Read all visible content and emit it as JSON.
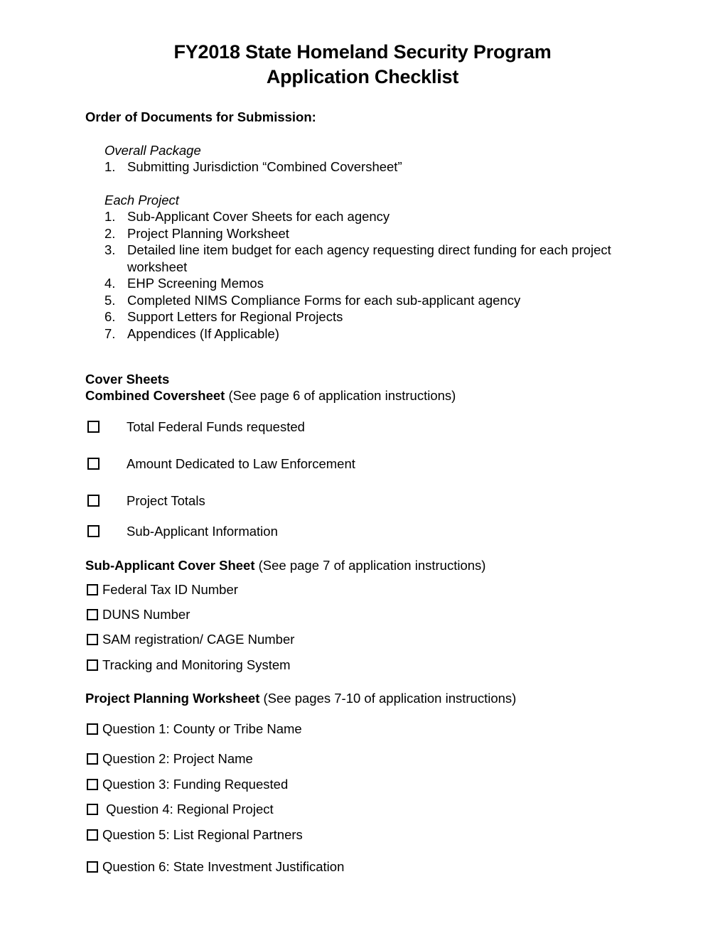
{
  "document": {
    "title_line1": "FY2018 State Homeland Security Program",
    "title_line2": "Application Checklist",
    "order_heading": "Order of Documents for Submission:"
  },
  "order_of_documents": {
    "groups": [
      {
        "name": "overall-package",
        "heading": "Overall Package",
        "items": [
          {
            "number": "1.",
            "text": "Submitting Jurisdiction “Combined Coversheet”"
          }
        ]
      },
      {
        "name": "each-project",
        "heading": "Each Project",
        "items": [
          {
            "number": "1.",
            "text": "Sub-Applicant Cover Sheets for each agency"
          },
          {
            "number": "2.",
            "text": "Project Planning Worksheet"
          },
          {
            "number": "3.",
            "text": "Detailed line item budget for each agency requesting direct funding for each project worksheet"
          },
          {
            "number": "4.",
            "text": "EHP Screening Memos"
          },
          {
            "number": "5.",
            "text": "Completed NIMS Compliance Forms for each sub-applicant agency"
          },
          {
            "number": "6.",
            "text": "Support Letters for Regional Projects"
          },
          {
            "number": "7.",
            "text": "Appendices (If Applicable)"
          }
        ]
      }
    ]
  },
  "cover_sheets": {
    "section_heading": "Cover Sheets",
    "combined": {
      "label": "Combined Coversheet",
      "note": " (See page 6 of application instructions)",
      "items": [
        {
          "label": "Total Federal Funds requested",
          "checked": false
        },
        {
          "label": "Amount Dedicated to Law Enforcement",
          "checked": false
        },
        {
          "label": "Project Totals",
          "checked": false
        },
        {
          "label": "Sub-Applicant Information",
          "checked": false
        }
      ]
    },
    "sub_applicant": {
      "label": "Sub-Applicant Cover Sheet",
      "note": " (See page 7 of application instructions)",
      "items": [
        {
          "label": "Federal Tax ID Number",
          "checked": false
        },
        {
          "label": "DUNS Number",
          "checked": false
        },
        {
          "label": "SAM registration/ CAGE Number",
          "checked": false
        },
        {
          "label": "Tracking and Monitoring System",
          "checked": false
        }
      ]
    }
  },
  "project_planning_worksheet": {
    "label": "Project Planning Worksheet",
    "note": " (See pages 7-10 of application instructions)",
    "items": [
      {
        "label": "Question 1: County or Tribe Name",
        "checked": false
      },
      {
        "label": "Question 2: Project Name",
        "checked": false
      },
      {
        "label": "Question 3: Funding Requested",
        "checked": false
      },
      {
        "label": " Question 4: Regional Project",
        "checked": false
      },
      {
        "label": "Question 5: List Regional Partners",
        "checked": false
      },
      {
        "label": "Question 6: State Investment Justification",
        "checked": false
      }
    ]
  }
}
